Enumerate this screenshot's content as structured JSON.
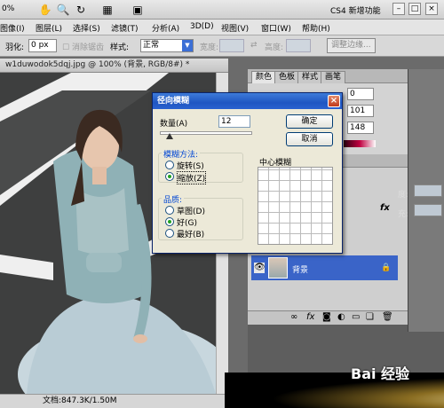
{
  "appbar": {
    "zoom": "0%",
    "icons": [
      "hand-tool-icon",
      "zoom-tool-icon",
      "rotate-view-icon",
      "grid-icon",
      "arrange-documents-icon",
      "screen-mode-icon"
    ],
    "workspace": "CS4 新增功能",
    "window_buttons": [
      "–",
      "□",
      "×"
    ]
  },
  "menubar": {
    "items": [
      "图像(I)",
      "图层(L)",
      "选择(S)",
      "滤镜(T)",
      "分析(A)",
      "3D(D)",
      "视图(V)",
      "窗口(W)",
      "帮助(H)"
    ]
  },
  "options": {
    "feather_label": "羽化:",
    "feather_value": "0 px",
    "antialias_label": "消除锯齿",
    "style_label": "样式:",
    "style_value": "正常",
    "width_label": "宽度:",
    "height_label": "高度:",
    "refine_button": "调整边缘..."
  },
  "document": {
    "title": "w1duwodok5dqj.jpg @ 100% (背景, RGB/8#) *",
    "status": "文档:847.3K/1.50M"
  },
  "color_panel": {
    "tabs": [
      "颜色",
      "色板",
      "样式",
      "画笔"
    ],
    "values": [
      "0",
      "101",
      "148"
    ]
  },
  "layers_panel": {
    "fx_label": "fx",
    "layer_name": "背景",
    "footer_icons": [
      "link-icon",
      "fx-icon",
      "mask-icon",
      "adjustment-icon",
      "folder-icon",
      "new-layer-icon",
      "trash-icon"
    ],
    "side_labels": [
      "度:",
      "充:"
    ]
  },
  "dialog": {
    "title": "径向模糊",
    "amount_label": "数量(A)",
    "amount_value": "12",
    "ok_button": "确定",
    "cancel_button": "取消",
    "method_group": "模糊方法:",
    "method_options": [
      "旋转(S)",
      "缩放(Z)"
    ],
    "method_selected": 1,
    "quality_group": "品质:",
    "quality_options": [
      "草图(D)",
      "好(G)",
      "最好(B)"
    ],
    "quality_selected": 1,
    "center_label": "中心模糊"
  },
  "watermark": "Bai 经验"
}
